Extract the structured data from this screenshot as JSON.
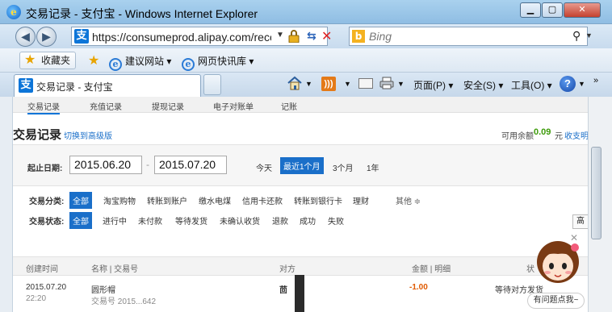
{
  "window": {
    "title": "交易记录 - 支付宝 - Windows Internet Explorer",
    "min": "▁",
    "max": "▢",
    "close": "✕"
  },
  "nav": {
    "back": "◀",
    "forward": "▶",
    "url": "https://consumeprod.alipay.com/record/",
    "site_icon": "支",
    "search_placeholder": "Bing",
    "bing_icon": "b"
  },
  "favorites": {
    "label": "收藏夹",
    "links": [
      "建议网站 ▾",
      "网页快讯库 ▾"
    ]
  },
  "tab": {
    "label": "交易记录 - 支付宝",
    "icon": "支"
  },
  "commands": {
    "page": "页面(P) ▾",
    "safety": "安全(S) ▾",
    "tools": "工具(O) ▾",
    "help": "?",
    "more": "»"
  },
  "subnav": [
    "交易记录",
    "充值记录",
    "提现记录",
    "电子对账单",
    "记账"
  ],
  "header": {
    "title": "交易记录",
    "switch_link": "切换到高级版",
    "balance_label": "可用余额",
    "balance_value": "0.09",
    "balance_unit": "元",
    "recharge_link": "收支明"
  },
  "date_filter": {
    "label": "起止日期:",
    "start": "2015.06.20",
    "separator": "-",
    "end": "2015.07.20",
    "quick": [
      "今天",
      "最近1个月",
      "3个月",
      "1年"
    ]
  },
  "filters": {
    "type_label": "交易分类:",
    "types": [
      "全部",
      "淘宝购物",
      "转账到账户",
      "缴水电煤",
      "信用卡还款",
      "转账到银行卡",
      "理财"
    ],
    "more": "其他 ≑",
    "status_label": "交易状态:",
    "statuses": [
      "全部",
      "进行中",
      "未付款",
      "等待发货",
      "未确认收货",
      "退款",
      "成功",
      "失败"
    ],
    "advanced": "高",
    "close": "✕"
  },
  "table": {
    "headers": [
      "创建时间",
      "名称 | 交易号",
      "对方",
      "金额 | 明细",
      "状"
    ],
    "rows": [
      {
        "date": "2015.07.20",
        "time": "22:20",
        "name": "圆形帽",
        "txno": "交易号 2015...642",
        "party": "茴",
        "amount": "-1.00",
        "status": "等待对方发货"
      }
    ]
  },
  "helper": {
    "bubble": "有问题点我~"
  }
}
